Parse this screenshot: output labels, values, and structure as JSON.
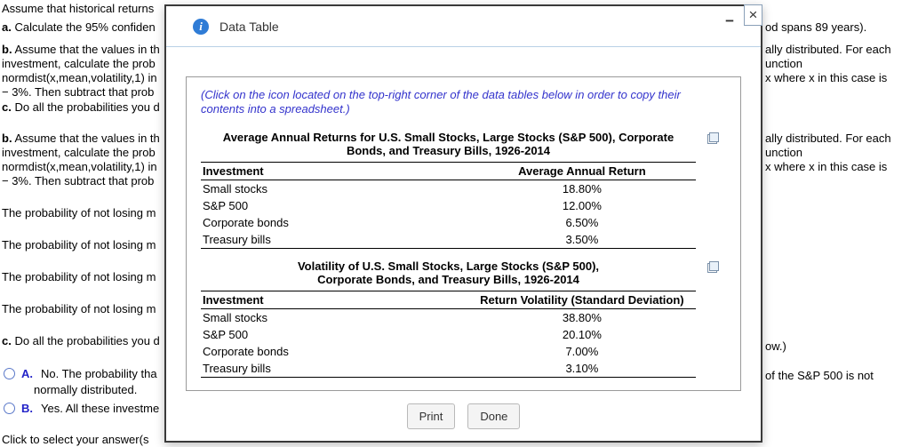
{
  "bg": {
    "left": [
      {
        "t": "Assume that historical returns"
      },
      {
        "b": "a.",
        "t": " Calculate the 95% confiden"
      },
      {
        "b": "b.",
        "t": " Assume that the values in th"
      },
      {
        "t": "investment, calculate the prob"
      },
      {
        "t": "normdist(x,mean,volatility,1) in"
      },
      {
        "t": "− 3%. Then subtract that prob"
      },
      {
        "b": "c.",
        "t": " Do all the probabilities you d"
      },
      {
        "b": "b.",
        "t": " Assume that the values in th"
      },
      {
        "t": "investment, calculate the prob"
      },
      {
        "t": "normdist(x,mean,volatility,1) in"
      },
      {
        "t": "− 3%. Then subtract that prob"
      },
      {
        "t": "The probability of not losing m"
      },
      {
        "t": "The probability of not losing m"
      },
      {
        "t": "The probability of not losing m"
      },
      {
        "t": "The probability of not losing m"
      },
      {
        "b": "c.",
        "t": " Do all the probabilities you d"
      },
      {
        "t": "normally distributed."
      },
      {
        "t": "Click to select your answer(s"
      }
    ],
    "right": [
      {
        "t": "od spans 89 years)."
      },
      {
        "t": "ally distributed. For each"
      },
      {
        "t": "unction"
      },
      {
        "t": "x where x in this case is"
      },
      {
        "t": "ally distributed. For each"
      },
      {
        "t": "unction"
      },
      {
        "t": "x where x in this case is"
      },
      {
        "t": "ow.)"
      },
      {
        "t": "of the S&P 500 is not"
      }
    ],
    "options": [
      {
        "label": "A.",
        "text": "No. The probability tha"
      },
      {
        "label": "B.",
        "text": "Yes. All these investme"
      }
    ]
  },
  "modal": {
    "title": "Data Table",
    "icons": {
      "info": "i",
      "minimize": "−",
      "close": "×"
    },
    "instruction": "(Click on the icon located on the top-right corner of the data tables below in order to copy their contents into a spreadsheet.)",
    "tables": [
      {
        "title_line1": "Average Annual Returns for U.S. Small Stocks, Large Stocks (S&P 500), Corporate",
        "title_line2": "Bonds, and Treasury Bills, 1926-2014",
        "columns": [
          "Investment",
          "Average Annual Return"
        ],
        "rows": [
          [
            "Small stocks",
            "18.80%"
          ],
          [
            "S&P 500",
            "12.00%"
          ],
          [
            "Corporate bonds",
            "6.50%"
          ],
          [
            "Treasury bills",
            "3.50%"
          ]
        ]
      },
      {
        "title_line1": "Volatility of U.S. Small Stocks, Large Stocks (S&P 500),",
        "title_line2": "Corporate Bonds, and Treasury Bills, 1926-2014",
        "columns": [
          "Investment",
          "Return Volatility (Standard Deviation)"
        ],
        "rows": [
          [
            "Small stocks",
            "38.80%"
          ],
          [
            "S&P 500",
            "20.10%"
          ],
          [
            "Corporate bonds",
            "7.00%"
          ],
          [
            "Treasury bills",
            "3.10%"
          ]
        ]
      }
    ],
    "buttons": {
      "print": "Print",
      "done": "Done"
    }
  }
}
